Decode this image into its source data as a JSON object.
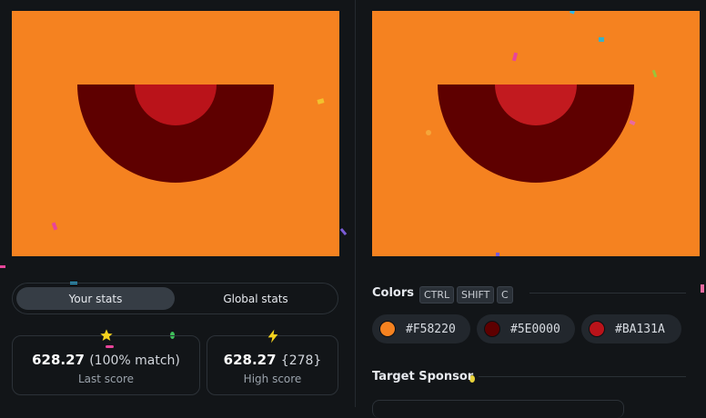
{
  "canvases": {
    "left_label": "",
    "right_label": ""
  },
  "colors_target": {
    "background": "#F58220",
    "dark": "#5E0000",
    "red": "#BA131A"
  },
  "stats_tabs": {
    "your_stats": "Your stats",
    "global_stats": "Global stats",
    "active": "your_stats"
  },
  "stats": {
    "last": {
      "value": "628.27",
      "extra": "(100% match)",
      "label": "Last score",
      "icon": "star-icon"
    },
    "high": {
      "value": "628.27",
      "extra": "{278}",
      "label": "High score",
      "icon": "lightning-icon"
    }
  },
  "colors_section": {
    "title": "Colors",
    "shortcut": [
      "CTRL",
      "SHIFT",
      "C"
    ],
    "swatches": [
      {
        "hex": "#F58220",
        "color": "#F58220"
      },
      {
        "hex": "#5E0000",
        "color": "#5E0000"
      },
      {
        "hex": "#BA131A",
        "color": "#BA131A"
      }
    ]
  },
  "sponsor_section": {
    "title": "Target Sponsor"
  }
}
